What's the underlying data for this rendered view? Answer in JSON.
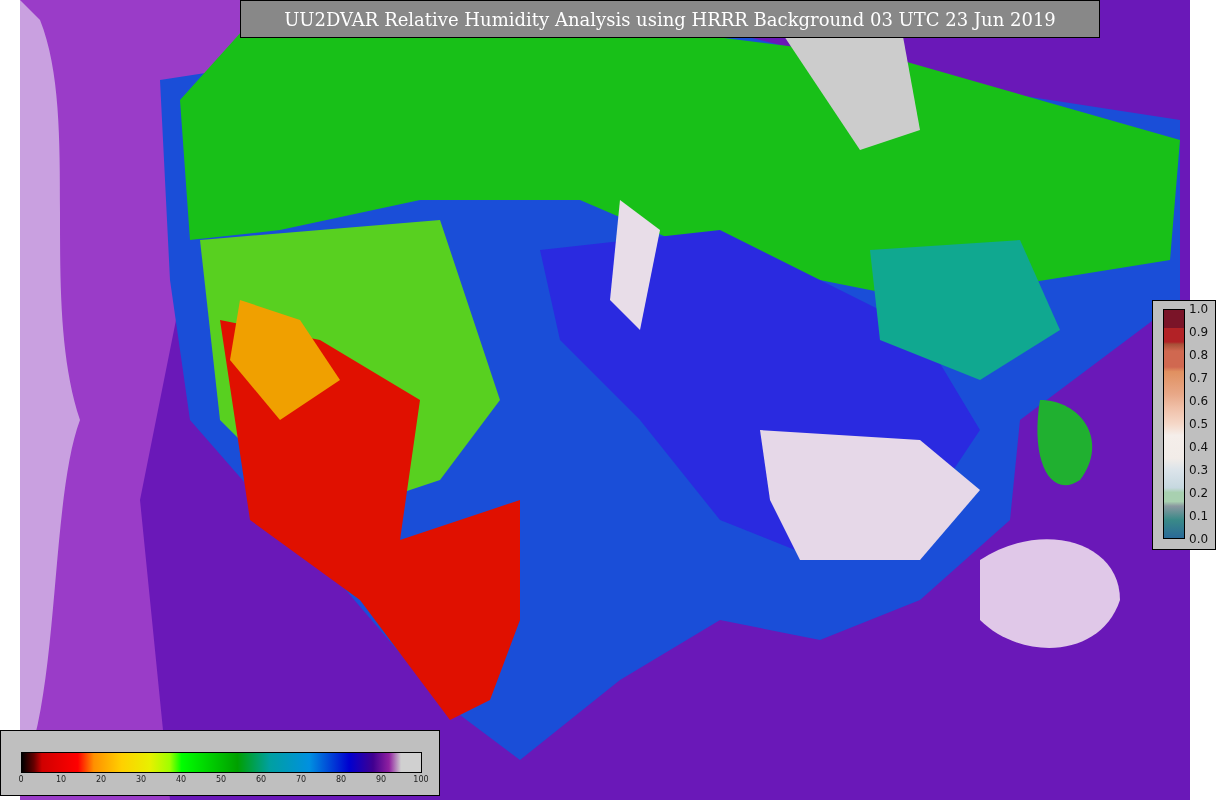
{
  "title": "UU2DVAR Relative Humidity Analysis using HRRR Background 03 UTC 23 Jun 2019",
  "side_colorbar": {
    "ticks": [
      "1.0",
      "0.9",
      "0.8",
      "0.7",
      "0.6",
      "0.5",
      "0.4",
      "0.3",
      "0.2",
      "0.1",
      "0.0"
    ]
  },
  "bottom_colorbar": {
    "ticks": [
      "0",
      "10",
      "20",
      "30",
      "40",
      "50",
      "60",
      "70",
      "80",
      "90",
      "100"
    ]
  }
}
